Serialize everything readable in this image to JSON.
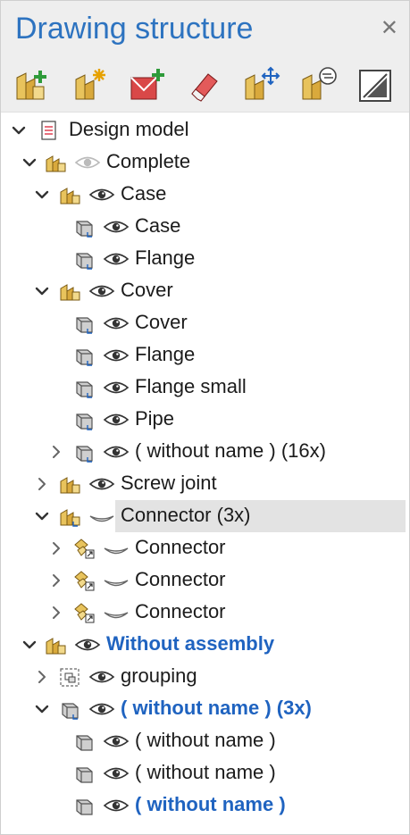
{
  "panel": {
    "title": "Drawing structure",
    "close_glyph": "✕"
  },
  "toolbar": {
    "buttons": [
      {
        "icon": "new-structure-element-icon"
      },
      {
        "icon": "new-assembly-icon"
      },
      {
        "icon": "new-view-icon"
      },
      {
        "icon": "eraser-icon"
      },
      {
        "icon": "move-element-icon"
      },
      {
        "icon": "element-options-icon"
      },
      {
        "icon": "display-mode-icon"
      }
    ]
  },
  "tree": {
    "root_label": "Design model",
    "complete": "Complete",
    "case_group": "Case",
    "case_item": "Case",
    "flange_1": "Flange",
    "cover_group": "Cover",
    "cover_item": "Cover",
    "flange_2": "Flange",
    "flange_small": "Flange small",
    "pipe": "Pipe",
    "without_name_16": "( without name ) (16x)",
    "screw_joint": "Screw joint",
    "connector_3x": "Connector (3x)",
    "connector_1": "Connector",
    "connector_2": "Connector",
    "connector_3": "Connector",
    "without_assembly": "Without assembly",
    "grouping": "grouping",
    "without_name_3x": "( without name ) (3x)",
    "without_name_a": "( without name )",
    "without_name_b": "( without name )",
    "without_name_c": "( without name )"
  },
  "colors": {
    "title": "#2d73c0",
    "bold_label": "#1f63c0",
    "selection": "#e3e3e3",
    "toolbar_bg": "#eeeeee"
  }
}
